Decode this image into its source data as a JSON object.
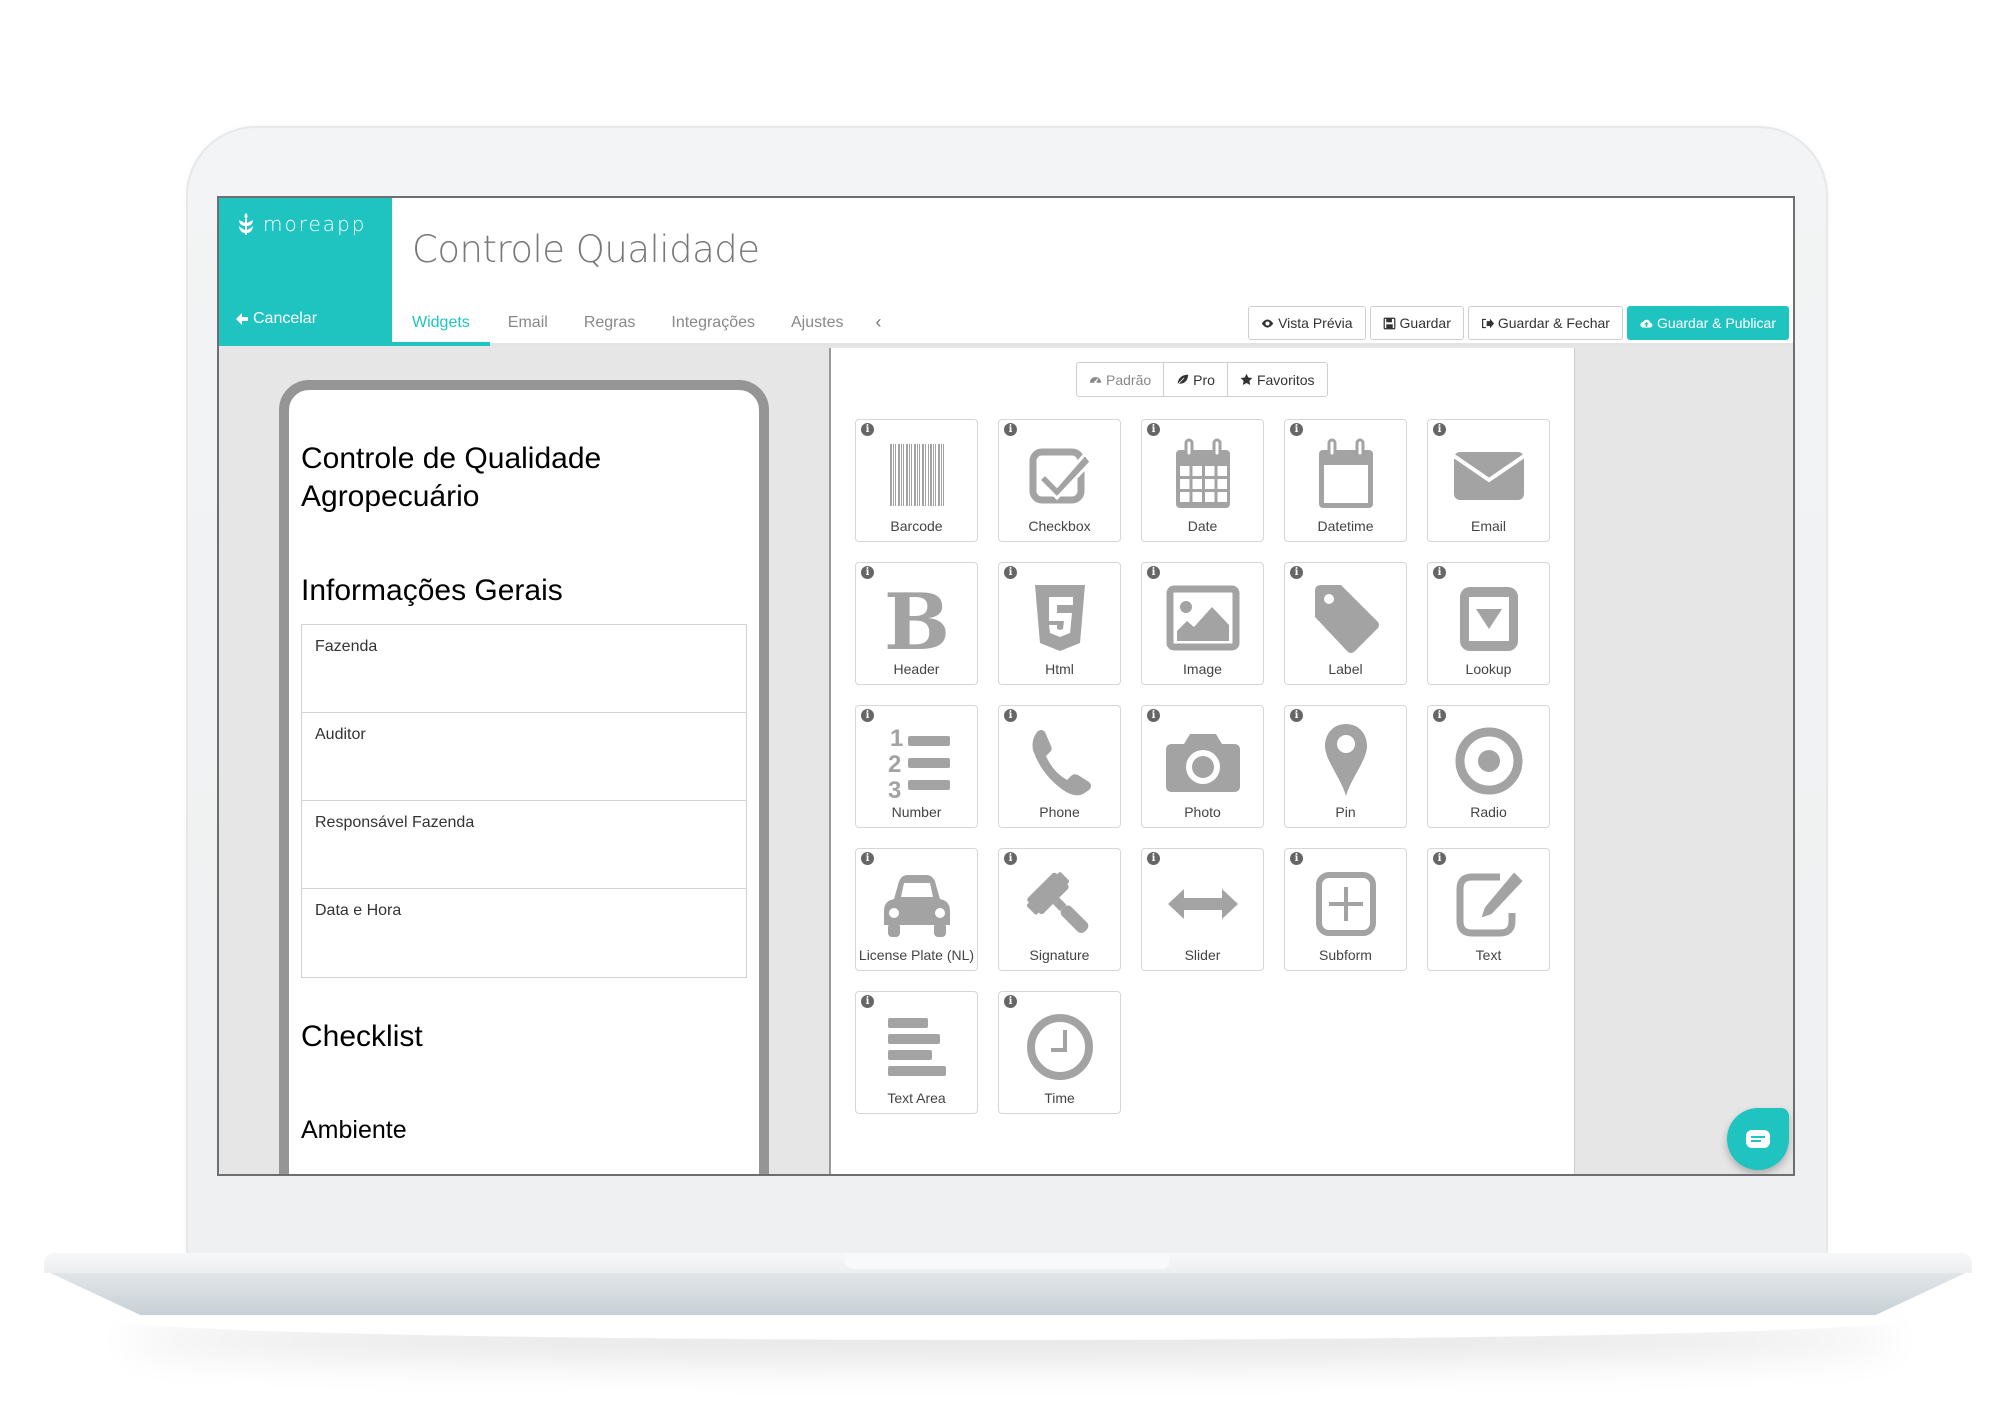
{
  "brand": {
    "logo_text": "moreapp",
    "cancel_label": "Cancelar",
    "accent_color": "#1fc4c1"
  },
  "header": {
    "title": "Controle Qualidade",
    "tabs": [
      {
        "label": "Widgets",
        "active": true
      },
      {
        "label": "Email",
        "active": false
      },
      {
        "label": "Regras",
        "active": false
      },
      {
        "label": "Integrações",
        "active": false
      },
      {
        "label": "Ajustes",
        "active": false
      }
    ],
    "actions": {
      "preview": "Vista Prévia",
      "save": "Guardar",
      "save_close": "Guardar & Fechar",
      "save_publish": "Guardar & Publicar"
    }
  },
  "preview": {
    "form_title": "Controle de Qualidade Agropecuário",
    "section_title": "Informações Gerais",
    "fields": [
      "Fazenda",
      "Auditor",
      "Responsável Fazenda",
      "Data e Hora"
    ],
    "checklist_title": "Checklist",
    "subsection_title": "Ambiente"
  },
  "widgets": {
    "filters": [
      {
        "label": "Padrão",
        "icon": "dashboard-icon"
      },
      {
        "label": "Pro",
        "icon": "leaf-icon"
      },
      {
        "label": "Favoritos",
        "icon": "star-icon"
      }
    ],
    "items": [
      {
        "label": "Barcode",
        "icon": "barcode-icon"
      },
      {
        "label": "Checkbox",
        "icon": "checkbox-icon"
      },
      {
        "label": "Date",
        "icon": "calendar-icon"
      },
      {
        "label": "Datetime",
        "icon": "calendar-empty-icon"
      },
      {
        "label": "Email",
        "icon": "envelope-icon"
      },
      {
        "label": "Header",
        "icon": "bold-icon"
      },
      {
        "label": "Html",
        "icon": "html5-icon"
      },
      {
        "label": "Image",
        "icon": "image-icon"
      },
      {
        "label": "Label",
        "icon": "tag-icon"
      },
      {
        "label": "Lookup",
        "icon": "dropdown-icon"
      },
      {
        "label": "Number",
        "icon": "ordered-list-icon"
      },
      {
        "label": "Phone",
        "icon": "phone-icon"
      },
      {
        "label": "Photo",
        "icon": "camera-icon"
      },
      {
        "label": "Pin",
        "icon": "map-pin-icon"
      },
      {
        "label": "Radio",
        "icon": "radio-icon"
      },
      {
        "label": "License Plate (NL)",
        "icon": "car-icon"
      },
      {
        "label": "Signature",
        "icon": "gavel-icon"
      },
      {
        "label": "Slider",
        "icon": "arrows-h-icon"
      },
      {
        "label": "Subform",
        "icon": "plus-square-icon"
      },
      {
        "label": "Text",
        "icon": "edit-icon"
      },
      {
        "label": "Text Area",
        "icon": "align-left-icon"
      },
      {
        "label": "Time",
        "icon": "clock-icon"
      }
    ]
  }
}
